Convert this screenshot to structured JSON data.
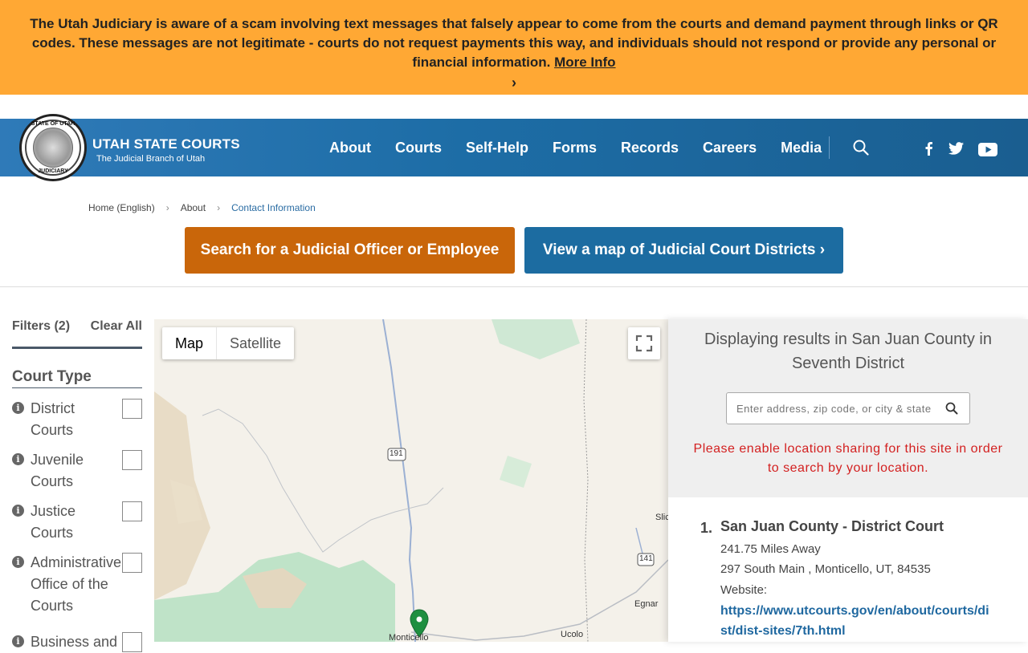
{
  "alert": {
    "text": "The Utah Judiciary is aware of a scam involving text messages that falsely appear to come from the courts and demand payment through links or QR codes. These messages are not legitimate - courts do not request payments this way, and individuals should not respond or provide any personal or financial information.",
    "link": "More Info",
    "chevron": "›"
  },
  "header": {
    "seal_top": "STATE OF UTAH",
    "seal_bottom": "JUDICIARY",
    "title": "UTAH STATE COURTS",
    "subtitle": "The Judicial Branch of Utah",
    "nav": [
      "About",
      "Courts",
      "Self-Help",
      "Forms",
      "Records",
      "Careers",
      "Media"
    ]
  },
  "breadcrumb": {
    "items": [
      "Home (English)",
      "About",
      "Contact Information"
    ],
    "sep": "›"
  },
  "buttons": {
    "search_officer": "Search for a Judicial Officer or Employee",
    "view_map": "View a map of Judicial Court Districts ›"
  },
  "filters": {
    "title": "Filters (2)",
    "clear": "Clear All",
    "court_type": "Court Type",
    "items": [
      "District Courts",
      "Juvenile Courts",
      "Justice Courts",
      "Administrative Office of the Courts",
      "Business and"
    ]
  },
  "map": {
    "map_label": "Map",
    "satellite_label": "Satellite",
    "labels": [
      "191",
      "141",
      "Monticello",
      "Ucolo",
      "Egnar",
      "Slic"
    ]
  },
  "results": {
    "title": "Displaying results in San Juan County in Seventh District",
    "search_placeholder": "Enter address, zip code, or city & state",
    "location_msg": "Please enable location sharing for this site in order to search by your location.",
    "items": [
      {
        "num": "1.",
        "name": "San Juan County - District Court",
        "distance": "241.75 Miles Away",
        "address": "297 South Main , Monticello, UT, 84535",
        "website_label": "Website:",
        "website": "https://www.utcourts.gov/en/about/courts/dist/dist-sites/7th.html"
      }
    ]
  },
  "colors": {
    "alert_bg": "#ffa834",
    "header_bg": "#1d6da6",
    "orange_btn": "#c9660a",
    "blue_btn": "#1c6ca1",
    "error_text": "#d32020",
    "link": "#1f68a0"
  }
}
